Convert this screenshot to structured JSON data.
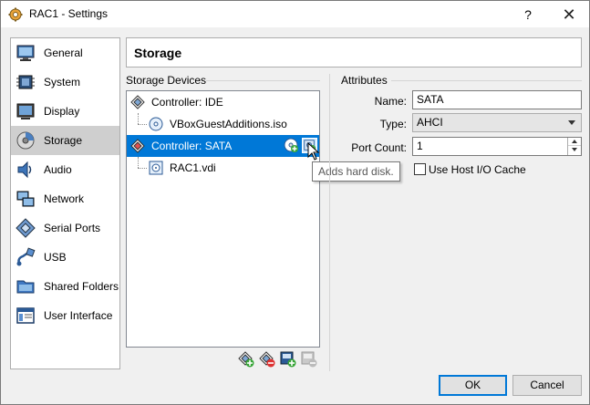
{
  "window": {
    "title": "RAC1 - Settings",
    "help": "?",
    "close": "✕"
  },
  "sidebar": {
    "items": [
      {
        "label": "General",
        "icon": "monitor-icon"
      },
      {
        "label": "System",
        "icon": "chip-icon"
      },
      {
        "label": "Display",
        "icon": "display-icon"
      },
      {
        "label": "Storage",
        "icon": "storage-icon",
        "active": true
      },
      {
        "label": "Audio",
        "icon": "speaker-icon"
      },
      {
        "label": "Network",
        "icon": "network-icon"
      },
      {
        "label": "Serial Ports",
        "icon": "serial-port-icon"
      },
      {
        "label": "USB",
        "icon": "usb-icon"
      },
      {
        "label": "Shared Folders",
        "icon": "folder-icon"
      },
      {
        "label": "User Interface",
        "icon": "user-interface-icon"
      }
    ]
  },
  "header": {
    "title": "Storage"
  },
  "storage_devices": {
    "label": "Storage Devices",
    "tree": [
      {
        "label": "Controller: IDE",
        "type": "controller"
      },
      {
        "label": "VBoxGuestAdditions.iso",
        "type": "optical"
      },
      {
        "label": "Controller: SATA",
        "type": "controller",
        "selected": true
      },
      {
        "label": "RAC1.vdi",
        "type": "disk"
      }
    ],
    "tooltip": "Adds hard disk."
  },
  "attributes": {
    "label": "Attributes",
    "name_label": "Name:",
    "name_value": "SATA",
    "type_label": "Type:",
    "type_value": "AHCI",
    "port_count_label": "Port Count:",
    "port_count_value": "1",
    "host_io_label": "Use Host I/O Cache",
    "host_io_checked": false
  },
  "footer": {
    "ok_label": "OK",
    "cancel_label": "Cancel"
  },
  "colors": {
    "selection": "#0078d7",
    "active_sidebar": "#cfcfcf"
  }
}
